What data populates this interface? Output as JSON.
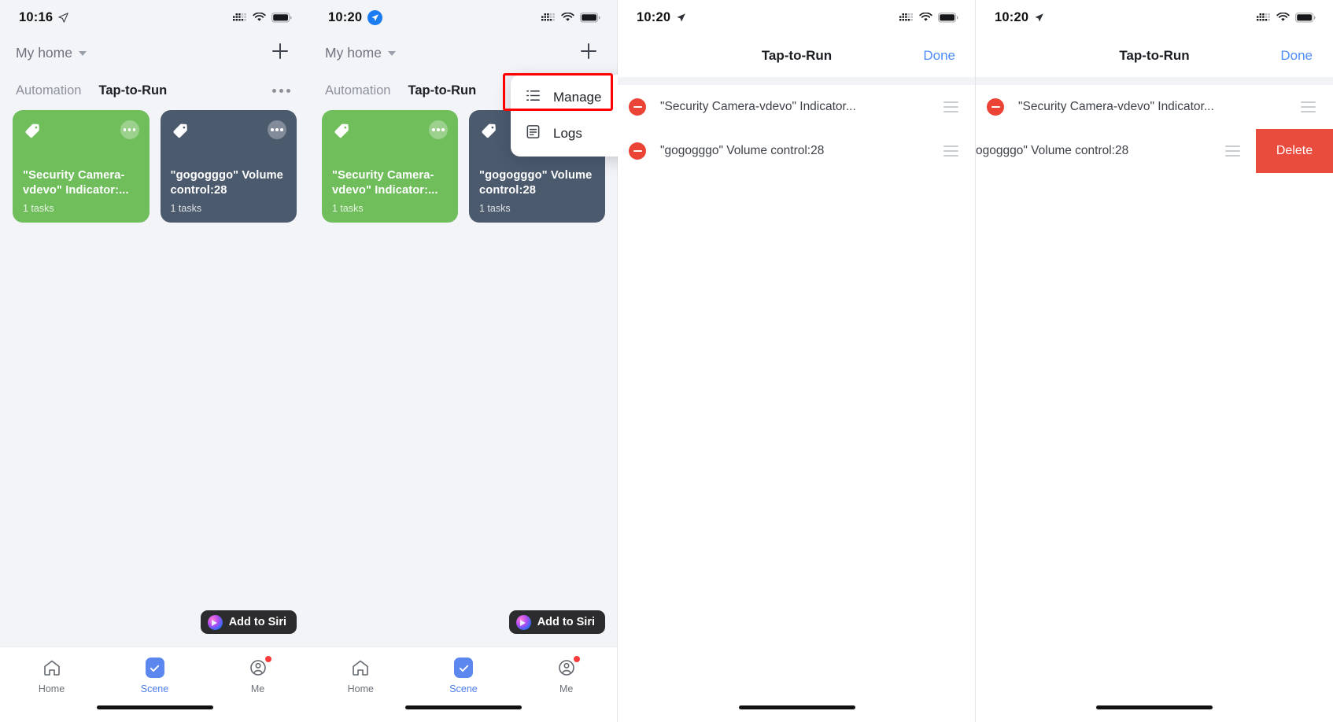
{
  "panels": {
    "p1": {
      "status": {
        "time": "10:16",
        "location_icon": "location-arrow-icon",
        "cellular_icon": "cellular-signal-icon",
        "wifi_icon": "wifi-icon",
        "battery_icon": "battery-full-icon"
      },
      "header": {
        "home_name": "My home",
        "add_label": "+",
        "caret_icon": "chevron-down-icon"
      },
      "tabs": [
        {
          "label": "Automation",
          "active": false
        },
        {
          "label": "Tap-to-Run",
          "active": true
        }
      ],
      "more_icon": "ellipsis-icon",
      "cards": [
        {
          "title": "\"Security Camera-vdevo\" Indicator:...",
          "subtitle": "1 tasks",
          "color": "#70bd5c",
          "tag_icon": "tag-icon",
          "more_icon": "ellipsis-icon"
        },
        {
          "title": "\"gogogggo\" Volume control:28",
          "subtitle": "1 tasks",
          "color": "#4c5a6e",
          "tag_icon": "tag-icon",
          "more_icon": "ellipsis-icon"
        }
      ],
      "siri": {
        "label": "Add to Siri",
        "icon": "siri-orb-icon"
      },
      "tabbar": [
        {
          "label": "Home",
          "icon": "home-icon",
          "active": false,
          "badge": false
        },
        {
          "label": "Scene",
          "icon": "checkmark-icon",
          "active": true,
          "badge": false
        },
        {
          "label": "Me",
          "icon": "profile-icon",
          "active": false,
          "badge": true
        }
      ]
    },
    "p2": {
      "status": {
        "time": "10:20",
        "nav_badge_icon": "location-arrow-badge-icon",
        "cellular_icon": "cellular-signal-icon",
        "wifi_icon": "wifi-icon",
        "battery_icon": "battery-full-icon"
      },
      "header": {
        "home_name": "My home",
        "add_label": "+",
        "caret_icon": "chevron-down-icon"
      },
      "tabs": [
        {
          "label": "Automation",
          "active": false
        },
        {
          "label": "Tap-to-Run",
          "active": true
        }
      ],
      "more_icon": "ellipsis-icon",
      "cards": [
        {
          "title": "\"Security Camera-vdevo\" Indicator:...",
          "subtitle": "1 tasks",
          "color": "#70bd5c",
          "tag_icon": "tag-icon",
          "more_icon": "ellipsis-icon"
        },
        {
          "title": "\"gogogggo\" Volume control:28",
          "subtitle": "1 tasks",
          "color": "#4c5a6e",
          "tag_icon": "tag-icon",
          "more_icon": "ellipsis-icon"
        }
      ],
      "menu": [
        {
          "label": "Manage",
          "icon": "list-lines-icon",
          "highlighted": true
        },
        {
          "label": "Logs",
          "icon": "document-lines-icon",
          "highlighted": false
        }
      ],
      "highlight_color": "#ff0000",
      "siri": {
        "label": "Add to Siri",
        "icon": "siri-orb-icon"
      },
      "tabbar": [
        {
          "label": "Home",
          "icon": "home-icon",
          "active": false,
          "badge": false
        },
        {
          "label": "Scene",
          "icon": "checkmark-icon",
          "active": true,
          "badge": false
        },
        {
          "label": "Me",
          "icon": "profile-icon",
          "active": false,
          "badge": true
        }
      ]
    },
    "p3": {
      "status": {
        "time": "10:20",
        "location_icon": "location-arrow-icon",
        "cellular_icon": "cellular-signal-icon",
        "wifi_icon": "wifi-icon",
        "battery_icon": "battery-full-icon"
      },
      "navbar": {
        "title": "Tap-to-Run",
        "done_label": "Done"
      },
      "rows": [
        {
          "text": "\"Security Camera-vdevo\" Indicator...",
          "delete_icon": "minus-circle-icon",
          "reorder_icon": "reorder-grip-icon"
        },
        {
          "text": "\"gogogggo\" Volume control:28",
          "delete_icon": "minus-circle-icon",
          "reorder_icon": "reorder-grip-icon"
        }
      ]
    },
    "p4": {
      "status": {
        "time": "10:20",
        "location_icon": "location-arrow-icon",
        "cellular_icon": "cellular-signal-icon",
        "wifi_icon": "wifi-icon",
        "battery_icon": "battery-full-icon"
      },
      "navbar": {
        "title": "Tap-to-Run",
        "done_label": "Done"
      },
      "rows": [
        {
          "text": "\"Security Camera-vdevo\" Indicator...",
          "delete_icon": "minus-circle-icon",
          "reorder_icon": "reorder-grip-icon",
          "swiped": false
        },
        {
          "text": "ogogggo\" Volume control:28",
          "reorder_icon": "reorder-grip-icon",
          "swiped": true,
          "delete_label": "Delete"
        }
      ],
      "delete_color": "#e94b3c"
    }
  }
}
